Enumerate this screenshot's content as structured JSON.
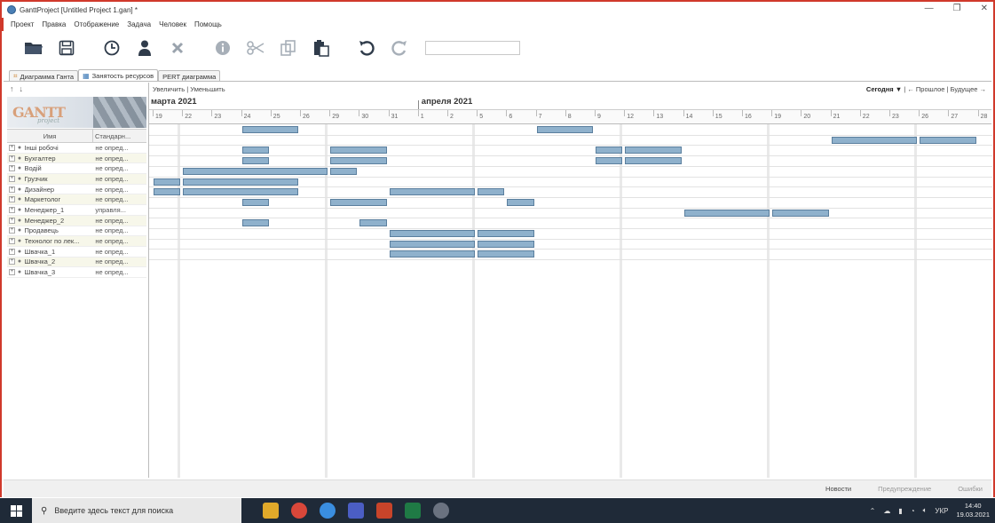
{
  "window": {
    "title": "GanttProject [Untitled Project 1.gan] *",
    "minimize": "—",
    "maximize": "❐",
    "close": "✕"
  },
  "menu": [
    "Проект",
    "Правка",
    "Отображение",
    "Задача",
    "Человек",
    "Помощь"
  ],
  "toolbar": {
    "icons": [
      "folder-open-icon",
      "save-icon",
      "clock-icon",
      "person-icon",
      "delete-icon",
      "info-icon",
      "cut-icon",
      "copy-icon",
      "paste-icon",
      "undo-icon",
      "redo-icon"
    ],
    "search_value": ""
  },
  "tabs": [
    {
      "label": "Диаграмма Ганта",
      "active": false
    },
    {
      "label": "Занятость ресурсов",
      "active": true
    },
    {
      "label": "PERT диаграмма",
      "active": false
    }
  ],
  "left_panel": {
    "logo_text": "GANTT",
    "logo_sub": "project",
    "columns": {
      "name": "Имя",
      "role": "Стандарн..."
    },
    "resources": [
      {
        "name": "Інші робочі",
        "role": "не опред..."
      },
      {
        "name": "Бухгалтер",
        "role": "не опред..."
      },
      {
        "name": "Водій",
        "role": "не опред..."
      },
      {
        "name": "Грузчик",
        "role": "не опред..."
      },
      {
        "name": "Дизайнер",
        "role": "не опред..."
      },
      {
        "name": "Маркетолог",
        "role": "не опред..."
      },
      {
        "name": "Менеджер_1",
        "role": "управля..."
      },
      {
        "name": "Менеджер_2",
        "role": "не опред..."
      },
      {
        "name": "Продавець",
        "role": "не опред..."
      },
      {
        "name": "Технолог по лек...",
        "role": "не опред..."
      },
      {
        "name": "Швачка_1",
        "role": "не опред..."
      },
      {
        "name": "Швачка_2",
        "role": "не опред..."
      },
      {
        "name": "Швачка_3",
        "role": "не опред..."
      }
    ]
  },
  "chart_header": {
    "zoom": "Увеличить | Уменьшить",
    "today": "Сегодня ▼",
    "past": "| ← Прошлое |",
    "future": "Будущее →"
  },
  "timeline": {
    "months": [
      "марта 2021",
      "апреля 2021"
    ],
    "days": [
      "19",
      "22",
      "23",
      "24",
      "25",
      "26",
      "29",
      "30",
      "31",
      "1",
      "2",
      "5",
      "6",
      "7",
      "8",
      "9",
      "12",
      "13",
      "14",
      "15",
      "16",
      "19",
      "20",
      "21",
      "22",
      "23",
      "26",
      "27",
      "28"
    ]
  },
  "assignments": [
    {
      "row": 0,
      "bars": [
        [
          3,
          4
        ],
        [
          13,
          14
        ]
      ]
    },
    {
      "row": 1,
      "bars": [
        [
          23,
          25
        ],
        [
          26,
          27
        ]
      ]
    },
    {
      "row": 2,
      "bars": [
        [
          3,
          3
        ],
        [
          6,
          7
        ],
        [
          15,
          15
        ],
        [
          16,
          17
        ]
      ]
    },
    {
      "row": 3,
      "bars": [
        [
          3,
          3
        ],
        [
          6,
          7
        ],
        [
          15,
          15
        ],
        [
          16,
          17
        ]
      ]
    },
    {
      "row": 4,
      "bars": [
        [
          1,
          5
        ],
        [
          6,
          6
        ]
      ]
    },
    {
      "row": 5,
      "bars": [
        [
          0,
          0
        ],
        [
          1,
          4
        ]
      ]
    },
    {
      "row": 6,
      "bars": [
        [
          0,
          0
        ],
        [
          1,
          4
        ],
        [
          8,
          10
        ],
        [
          11,
          11
        ]
      ]
    },
    {
      "row": 7,
      "bars": [
        [
          3,
          3
        ],
        [
          6,
          7
        ],
        [
          12,
          12
        ]
      ]
    },
    {
      "row": 8,
      "bars": [
        [
          18,
          20
        ],
        [
          21,
          22
        ]
      ]
    },
    {
      "row": 9,
      "bars": [
        [
          3,
          3
        ],
        [
          7,
          7
        ]
      ]
    },
    {
      "row": 10,
      "bars": [
        [
          8,
          10
        ],
        [
          11,
          12
        ]
      ]
    },
    {
      "row": 11,
      "bars": [
        [
          8,
          10
        ],
        [
          11,
          12
        ]
      ]
    },
    {
      "row": 12,
      "bars": [
        [
          8,
          10
        ],
        [
          11,
          12
        ]
      ]
    }
  ],
  "statusbar": {
    "news": "Новости",
    "warnings": "Предупреждение",
    "errors": "Ошибки"
  },
  "taskbar": {
    "search_placeholder": "Введите здесь текст для поиска",
    "lang": "УКР",
    "time": "14:40",
    "date": "19.03.2021"
  }
}
